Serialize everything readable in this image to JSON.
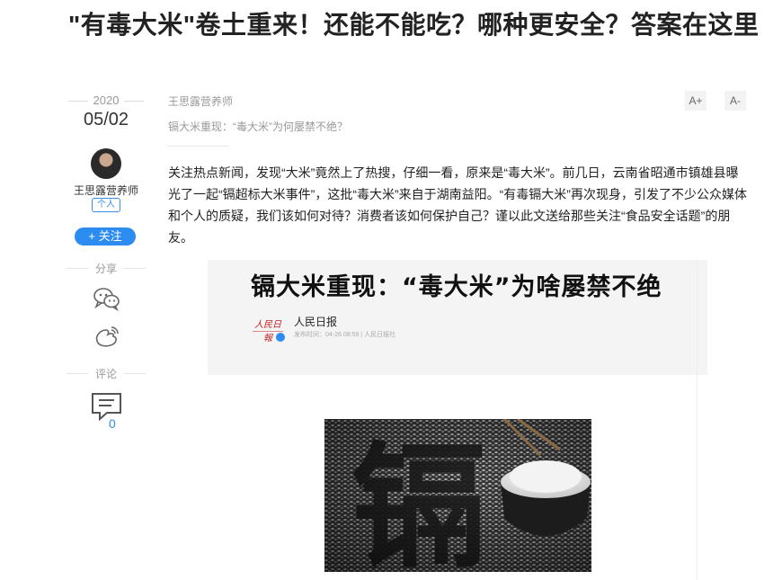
{
  "article": {
    "title": "\"有毒大米\"卷土重来！还能不能吃？哪种更安全？答案在这里",
    "year": "2020",
    "date": "05/02",
    "author": "王思露营养师",
    "author_badge": "个人",
    "follow_label": "+ 关注",
    "share_label": "分享",
    "comment_label": "评论",
    "comment_count": "0",
    "font_increase": "A+",
    "font_decrease": "A-",
    "subtitle": "镉大米重现：“毒大米”为何屡禁不绝？",
    "body": "关注热点新闻，发现“大米”竟然上了热搜，仔细一看，原来是“毒大米”。前几日，云南省昭通市镇雄县曝光了一起“镉超标大米事件”，这批“毒大米”来自于湖南益阳。“有毒镉大米”再次现身，引发了不少公众媒体和个人的质疑，我们该如何对待？消费者该如何保护自己？谨以此文送给那些关注“食品安全话题”的朋友。"
  },
  "embedded_card": {
    "headline": "镉大米重现：“毒大米”为啥屡禁不绝",
    "logo_text": "人民日報",
    "source": "人民日报",
    "meta": "发布时间：04-26  08:59  |  人民日报社"
  },
  "rice_image": {
    "character": "镉"
  },
  "icons": {
    "share_wechat": "wechat-icon",
    "share_weibo": "weibo-icon",
    "comment": "comment-icon"
  },
  "colors": {
    "accent": "#2d8cf0",
    "title": "#222222",
    "muted": "#999999"
  }
}
